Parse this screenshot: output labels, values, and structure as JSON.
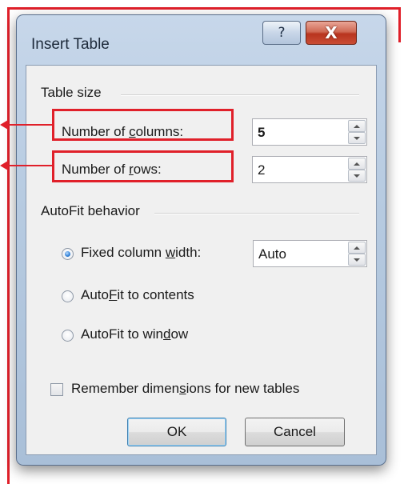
{
  "colors": {
    "annotation": "#e0202a",
    "window_frame": "#b7cbe1",
    "client_bg": "#f0f0f0"
  },
  "dialog": {
    "title": "Insert Table",
    "help_glyph": "?",
    "close_glyph": "X"
  },
  "table_size": {
    "group_label": "Table size",
    "columns_label_pre": "Number of ",
    "columns_label_u": "c",
    "columns_label_post": "olumns:",
    "columns_value": "5",
    "rows_label_pre": "Number of ",
    "rows_label_u": "r",
    "rows_label_post": "ows:",
    "rows_value": "2"
  },
  "autofit": {
    "group_label": "AutoFit behavior",
    "fixed_pre": "Fixed column ",
    "fixed_u": "w",
    "fixed_post": "idth:",
    "fixed_value": "Auto",
    "contents_pre": "Auto",
    "contents_u": "F",
    "contents_post": "it to contents",
    "window_pre": "AutoFit to win",
    "window_u": "d",
    "window_post": "ow",
    "selected": "fixed"
  },
  "remember": {
    "pre": "Remember dimen",
    "u": "s",
    "post": "ions for new tables"
  },
  "buttons": {
    "ok": "OK",
    "cancel": "Cancel"
  },
  "icons": {
    "help": "help-icon",
    "close": "close-icon",
    "spin_up": "chevron-up-icon",
    "spin_down": "chevron-down-icon"
  }
}
